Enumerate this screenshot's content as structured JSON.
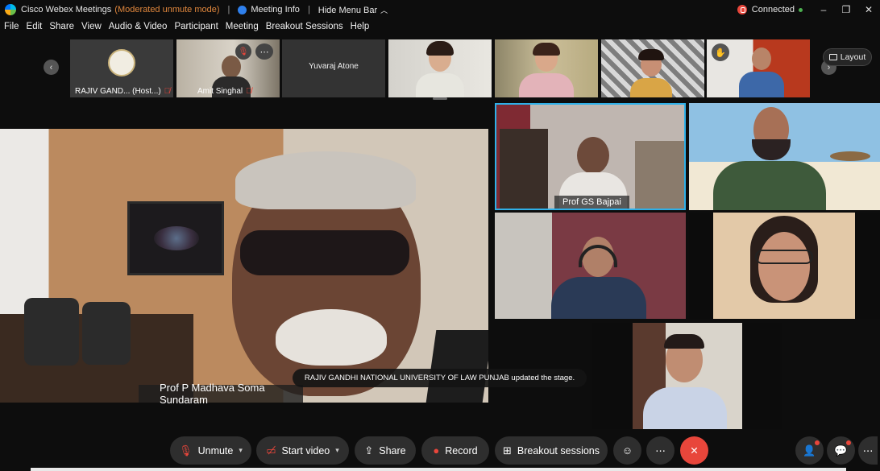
{
  "titlebar": {
    "app_name": "Cisco Webex Meetings",
    "mode": "(Moderated unmute mode)",
    "sep1": "|",
    "meeting_info": "Meeting Info",
    "sep2": "|",
    "hide_menu": "Hide Menu Bar",
    "status": "Connected",
    "min": "–",
    "restore": "❐",
    "close": "✕"
  },
  "menu": [
    "File",
    "Edit",
    "Share",
    "View",
    "Audio & Video",
    "Participant",
    "Meeting",
    "Breakout Sessions",
    "Help"
  ],
  "filmstrip": {
    "prev": "‹",
    "next": "›",
    "thumbs": [
      {
        "name": "RAJIV GAND... (Host...)",
        "muted": true
      },
      {
        "name": "Amit Singhal",
        "muted": true
      },
      {
        "name": "Yuvaraj Atone",
        "muted": false
      },
      {
        "name": "",
        "muted": false
      },
      {
        "name": "",
        "muted": false
      },
      {
        "name": "",
        "muted": false
      },
      {
        "name": "",
        "muted": false
      }
    ],
    "more_icon": "⋯",
    "layout_label": "Layout"
  },
  "stage": {
    "speaker_name": "Prof P Madhava Soma Sundaram",
    "toast": "RAJIV GANDHI NATIONAL UNIVERSITY OF LAW PUNJAB updated the stage."
  },
  "grid": {
    "active_speaker_label": "Prof GS Bajpai"
  },
  "toolbar": {
    "unmute": "Unmute",
    "start_video": "Start video",
    "share": "Share",
    "record": "Record",
    "breakout": "Breakout sessions",
    "more": "⋯",
    "end": "✕"
  },
  "colors": {
    "accent_red": "#e8463b",
    "moderated_orange": "#e0873d",
    "active_border": "#2fb0e8"
  }
}
